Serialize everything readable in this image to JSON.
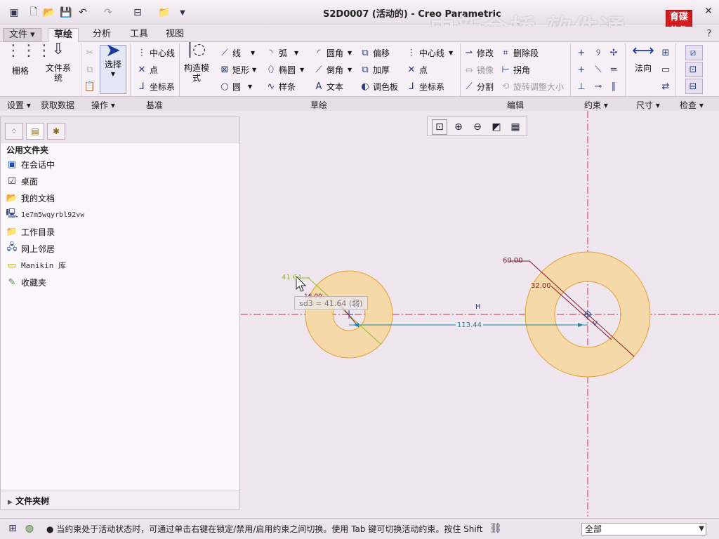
{
  "window": {
    "title": "S2D0007 (活动的) - Creo Parametric",
    "watermark": "中新金桥 软件通",
    "logo": "育碟软件"
  },
  "menubar": {
    "file": "文件",
    "tabs": [
      "草绘",
      "分析",
      "工具",
      "视图"
    ]
  },
  "ribbon": {
    "grid": "栅格",
    "file_system": "文件系统",
    "select": "选择",
    "construct_mode": "构造模式",
    "datum_centerline": "中心线",
    "datum_point": "点",
    "datum_csys": "坐标系",
    "sketch": {
      "line": "线",
      "arc": "弧",
      "fillet": "圆角",
      "offset": "偏移",
      "rectangle": "矩形",
      "ellipse": "椭圆",
      "chamfer": "倒角",
      "thicken": "加厚",
      "circle": "圆",
      "spline": "样条",
      "text": "文本",
      "palette": "调色板",
      "centerline": "中心线",
      "point": "点",
      "csys": "坐标系"
    },
    "edit": {
      "modify": "修改",
      "delete_segment": "删除段",
      "mirror": "镜像",
      "corner": "拐角",
      "divide": "分割",
      "rotate_resize": "旋转调整大小"
    },
    "normal": "法向",
    "groups": {
      "setup": "设置",
      "get_data": "获取数据",
      "operations": "操作",
      "datum": "基准",
      "sketching": "草绘",
      "editing": "编辑",
      "constrain": "约束",
      "dimension": "尺寸",
      "inspect": "检查"
    }
  },
  "navigator": {
    "header": "公用文件夹",
    "items": [
      {
        "label": "在会话中",
        "icon": "session-icon"
      },
      {
        "label": "桌面",
        "icon": "desktop-icon"
      },
      {
        "label": "我的文档",
        "icon": "documents-icon"
      },
      {
        "label": "1e7m5wqyrbl92vw",
        "icon": "computer-icon"
      },
      {
        "label": "工作目录",
        "icon": "working-dir-icon"
      },
      {
        "label": "网上邻居",
        "icon": "network-icon"
      },
      {
        "label": "Manikin 库",
        "icon": "folder-icon"
      },
      {
        "label": "收藏夹",
        "icon": "favorites-icon"
      }
    ],
    "footer": "文件夹树"
  },
  "sketch": {
    "dim_left_diameter": "41.64",
    "dim_left_inner": "16.00",
    "tooltip": "sd3 = 41.64 (弱)",
    "dim_distance": "113.44",
    "dim_right_outer": "60.00",
    "dim_right_inner": "32.00",
    "label_h": "H",
    "label_v": "V"
  },
  "status": {
    "message": "● 当约束处于活动状态时，可通过单击右键在锁定/禁用/启用约束之间切换。使用 Tab 键可切换活动约束。按住 Shift",
    "filter": "全部"
  },
  "colors": {
    "ring_fill": "#f5d9a8",
    "ring_stroke": "#e0a030",
    "dim_cyan": "#1a8aa0",
    "dim_red": "#8a1020",
    "dim_green": "#88c020",
    "axis_red": "#c03040"
  }
}
